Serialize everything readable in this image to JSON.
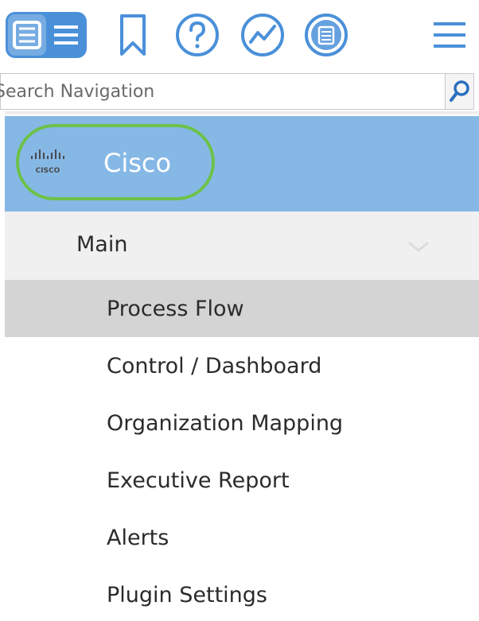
{
  "toolbar": {
    "buttons": [
      {
        "name": "list-view",
        "icon": "list-icon",
        "active": true
      },
      {
        "name": "bookmark",
        "icon": "bookmark-icon"
      },
      {
        "name": "help",
        "icon": "help-icon"
      },
      {
        "name": "activity",
        "icon": "chart-trend-icon"
      },
      {
        "name": "notes",
        "icon": "notes-icon"
      },
      {
        "name": "menu",
        "icon": "hamburger-icon"
      }
    ],
    "accent": "#4a90d9"
  },
  "search": {
    "placeholder": "Search Navigation"
  },
  "org": {
    "name": "Cisco",
    "logo_text": "CISCO",
    "header_color": "#86b8e6",
    "highlight_color": "#6cc24a"
  },
  "section": {
    "label": "Main"
  },
  "menu": {
    "items": [
      {
        "label": "Process Flow",
        "active": true
      },
      {
        "label": "Control / Dashboard"
      },
      {
        "label": "Organization Mapping"
      },
      {
        "label": "Executive Report"
      },
      {
        "label": "Alerts"
      },
      {
        "label": "Plugin Settings"
      }
    ]
  }
}
